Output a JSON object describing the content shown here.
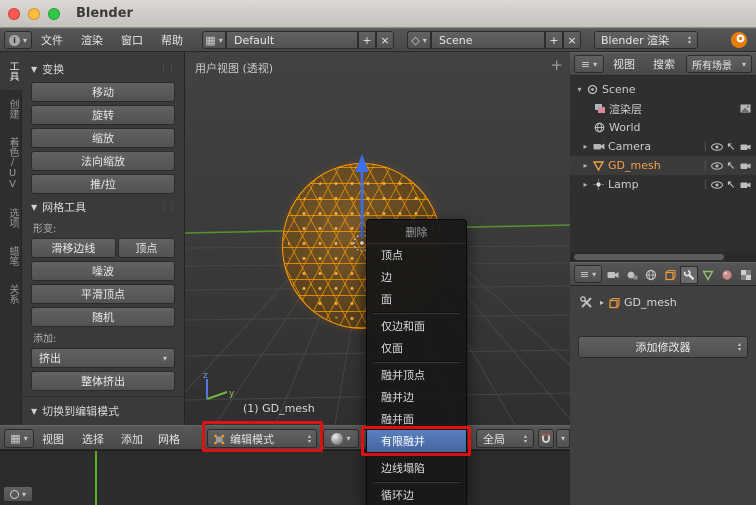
{
  "window": {
    "title": "Blender"
  },
  "glyphs": {
    "plus": "+",
    "close": "×",
    "caret": "▾",
    "caret_right": "▸",
    "panel_caret": "▼",
    "up": "▴",
    "down": "▾",
    "grip": "⋮⋮",
    "viewport_plus": "+"
  },
  "icon_glyphs": {
    "editor_grid": "▦",
    "editor_lines": "≡",
    "info_i": "i",
    "cursor_arrow": "↖",
    "pivot_dot": "◇"
  },
  "infobar": {
    "menus": [
      "文件",
      "渲染",
      "窗口",
      "帮助"
    ],
    "layout_value": "Default",
    "scene_value": "Scene",
    "engine_value": "Blender 渲染"
  },
  "tool_tabs": [
    "工具",
    "创建",
    "着色/UV",
    "选项",
    "蜡笔",
    "关系"
  ],
  "shelf": {
    "transform_title": "变换",
    "transform_buttons": [
      "移动",
      "旋转",
      "缩放",
      "法向缩放",
      "推/拉"
    ],
    "mesh_title": "网格工具",
    "deform_label": "形变:",
    "slide_button": "滑移边线",
    "vertex_button": "顶点",
    "noise_button": "噪波",
    "smooth_button": "平滑顶点",
    "random_button": "随机",
    "add_label": "添加:",
    "extrude_button": "挤出",
    "extrude_indiv_button": "整体挤出",
    "redo_title": "切换到编辑模式"
  },
  "viewport": {
    "view_label": "用户视图 (透视)",
    "object_info": "(1) GD_mesh",
    "axis_z": "z",
    "axis_y": "y"
  },
  "view_header": {
    "menus": [
      "视图",
      "选择",
      "添加",
      "网格"
    ],
    "mode_label": "编辑模式",
    "orientation_label": "全局"
  },
  "delete_menu": {
    "title": "删除",
    "items": [
      "顶点",
      "边",
      "面",
      "仅边和面",
      "仅面",
      "融并顶点",
      "融并边",
      "融并面",
      "有限融并",
      "边线塌陷",
      "循环边"
    ],
    "highlighted_item": "有限融并"
  },
  "outliner": {
    "menus": [
      "视图",
      "搜索"
    ],
    "display_filter": "所有场景",
    "rows": [
      {
        "label": "Scene"
      },
      {
        "label": "渲染层"
      },
      {
        "label": "World"
      },
      {
        "label": "Camera"
      },
      {
        "label": "GD_mesh"
      },
      {
        "label": "Lamp"
      }
    ]
  },
  "properties": {
    "object_name": "GD_mesh",
    "add_modifier_label": "添加修改器"
  },
  "colors": {
    "annotation_red": "#e01010",
    "menu_highlight_blue": "#4a72b5",
    "mesh_select_orange": "#ff9d00",
    "current_frame_green": "#5fae26"
  }
}
